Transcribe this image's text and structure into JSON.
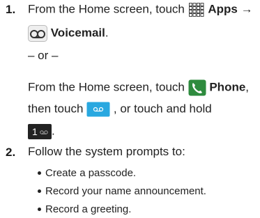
{
  "steps": [
    {
      "number": "1.",
      "line1": {
        "pre": "From the Home screen, touch",
        "bold1": "Apps",
        "arrow": "→"
      },
      "line2": {
        "bold": "Voicemail",
        "post": "."
      },
      "or": "– or –",
      "line4": {
        "pre": "From the Home screen, touch",
        "bold": "Phone",
        "post": ","
      },
      "line5": {
        "pre": "then touch",
        "post": ", or touch and hold"
      },
      "line6": {
        "key_label": "1",
        "post": "."
      }
    },
    {
      "number": "2.",
      "text": "Follow the system prompts to:",
      "bullets": [
        "Create a passcode.",
        "Record your name announcement.",
        "Record a greeting."
      ]
    }
  ],
  "colors": {
    "phone_icon": "#2e8b3e",
    "voicemail_button": "#29a8e0",
    "dark_key": "#222222",
    "text": "#222222"
  },
  "icons": [
    "apps-grid-icon",
    "voicemail-icon",
    "phone-icon",
    "voicemail-button-icon",
    "dial-key-1-icon"
  ]
}
